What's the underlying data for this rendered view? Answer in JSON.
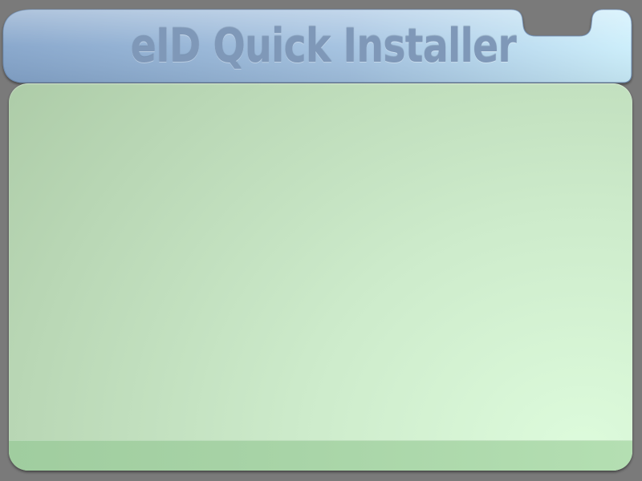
{
  "window": {
    "title": "eID Quick Installer"
  },
  "colors": {
    "background": "#7a7a7a",
    "titlebar_left": "#86a6cc",
    "titlebar_right": "#c9ecfa",
    "title_text": "#7f98b8",
    "panel_light": "#ddfbdc",
    "panel_dark": "#a7c6a1",
    "footer": "#a7d3a6"
  }
}
